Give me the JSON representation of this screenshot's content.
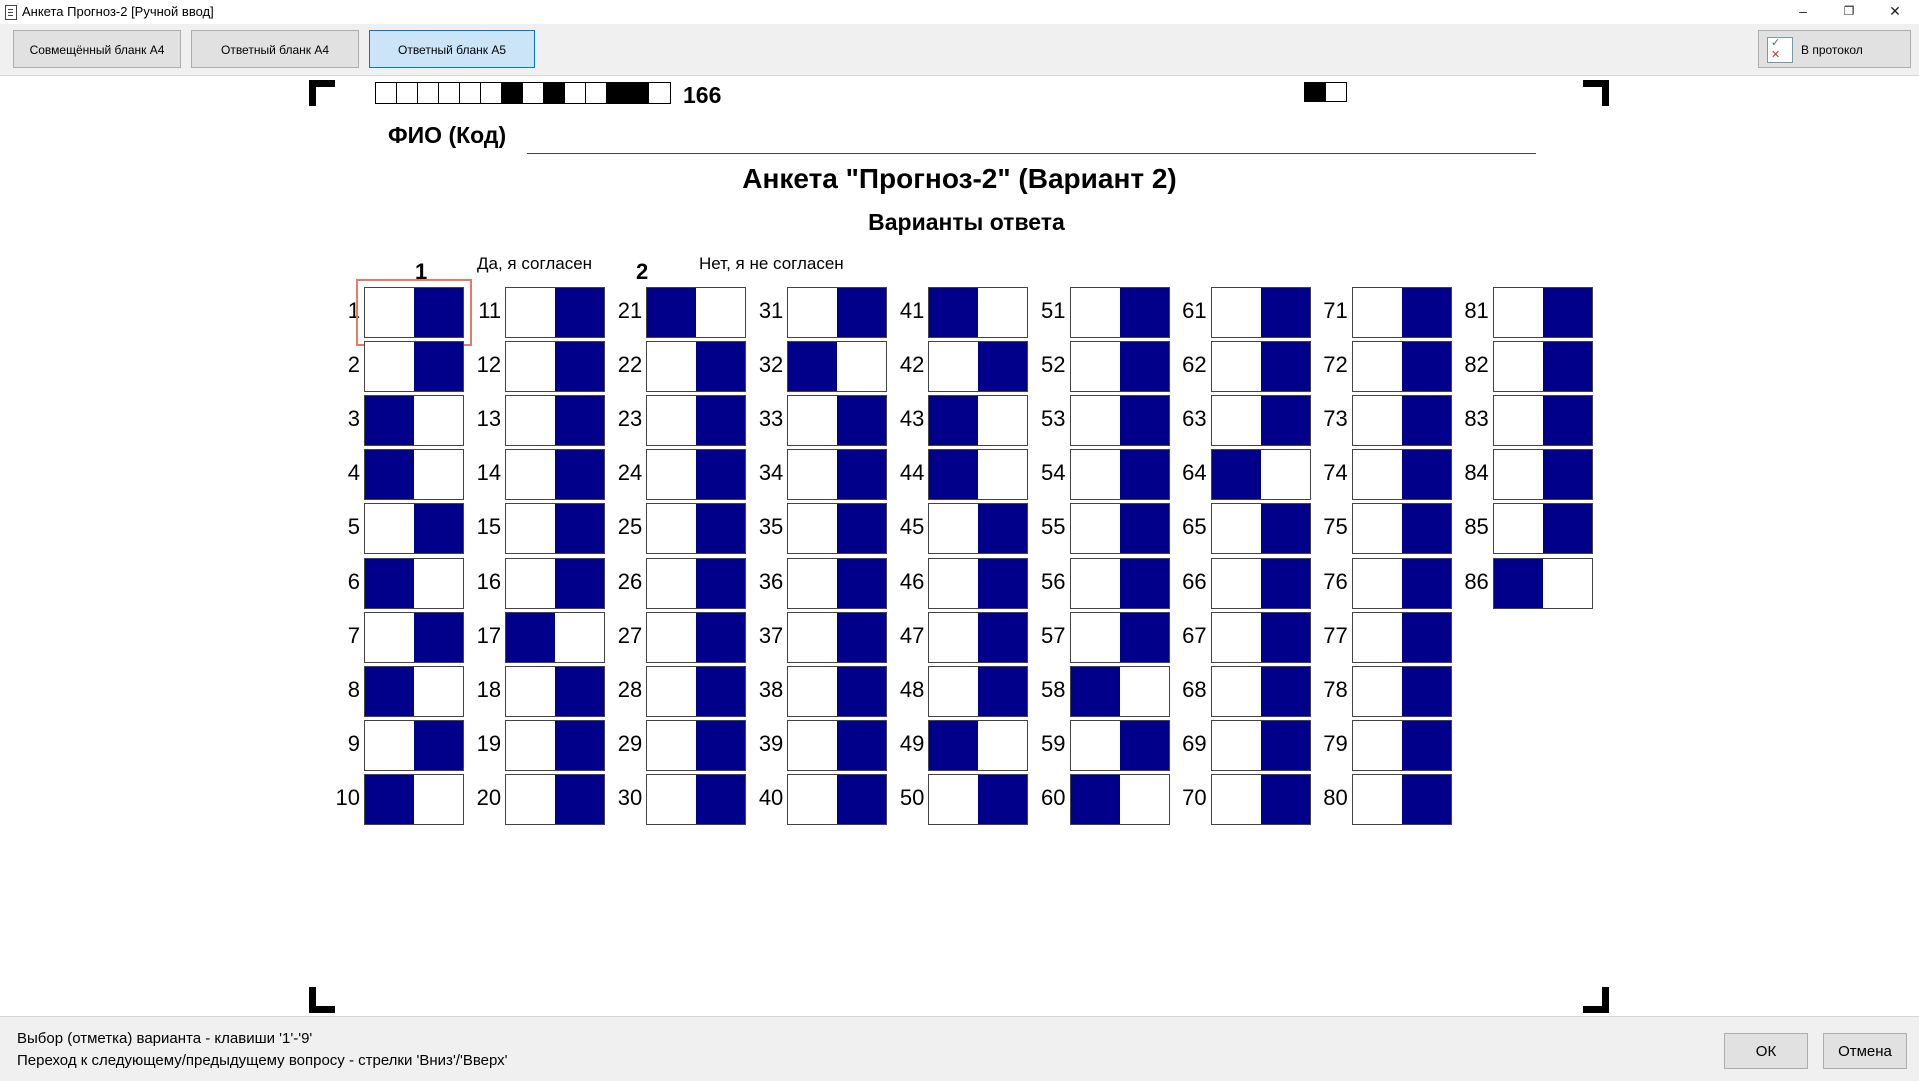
{
  "window": {
    "title": "Анкета Прогноз-2 [Ручной ввод]"
  },
  "toolbar": {
    "tabs": [
      "Совмещённый бланк А4",
      "Ответный бланк А4",
      "Ответный бланк А5"
    ],
    "active_tab": 2,
    "protocol_label": "В протокол"
  },
  "sheet": {
    "barcode_pattern": [
      0,
      0,
      0,
      0,
      0,
      0,
      1,
      0,
      1,
      0,
      0,
      1,
      1,
      0
    ],
    "barcode_number": "166",
    "fio_label": "ФИО (Код)",
    "title": "Анкета \"Прогноз-2\" (Вариант 2)",
    "subtitle": "Варианты ответа",
    "options": [
      {
        "num": "1",
        "label": "Да, я согласен"
      },
      {
        "num": "2",
        "label": "Нет, я не согласен"
      }
    ],
    "selected_question": 1
  },
  "answers": {
    "1": 2,
    "2": 2,
    "3": 1,
    "4": 1,
    "5": 2,
    "6": 1,
    "7": 2,
    "8": 1,
    "9": 2,
    "10": 1,
    "11": 2,
    "12": 2,
    "13": 2,
    "14": 2,
    "15": 2,
    "16": 2,
    "17": 1,
    "18": 2,
    "19": 2,
    "20": 2,
    "21": 1,
    "22": 2,
    "23": 2,
    "24": 2,
    "25": 2,
    "26": 2,
    "27": 2,
    "28": 2,
    "29": 2,
    "30": 2,
    "31": 2,
    "32": 1,
    "33": 2,
    "34": 2,
    "35": 2,
    "36": 2,
    "37": 2,
    "38": 2,
    "39": 2,
    "40": 2,
    "41": 1,
    "42": 2,
    "43": 1,
    "44": 1,
    "45": 2,
    "46": 2,
    "47": 2,
    "48": 2,
    "49": 1,
    "50": 2,
    "51": 2,
    "52": 2,
    "53": 2,
    "54": 2,
    "55": 2,
    "56": 2,
    "57": 2,
    "58": 1,
    "59": 2,
    "60": 1,
    "61": 2,
    "62": 2,
    "63": 2,
    "64": 1,
    "65": 2,
    "66": 2,
    "67": 2,
    "68": 2,
    "69": 2,
    "70": 2,
    "71": 2,
    "72": 2,
    "73": 2,
    "74": 2,
    "75": 2,
    "76": 2,
    "77": 2,
    "78": 2,
    "79": 2,
    "80": 2,
    "81": 2,
    "82": 2,
    "83": 2,
    "84": 2,
    "85": 2,
    "86": 1
  },
  "status": {
    "hint1": "Выбор (отметка) варианта - клавиши '1'-'9'",
    "hint2": "Переход к следующему/предыдущему вопросу - стрелки 'Вниз'/'Вверх'",
    "ok_label": "ОК",
    "cancel_label": "Отмена"
  },
  "colors": {
    "answer_fill": "#00008b",
    "selection_outline": "#e8796a",
    "active_tab": "#cce4f7"
  }
}
